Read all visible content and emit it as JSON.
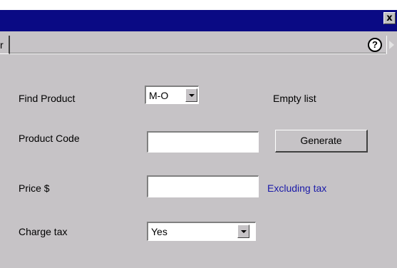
{
  "titlebar": {
    "close_glyph": "x"
  },
  "tabs": {
    "partial_tab_label": "r",
    "help_glyph": "?"
  },
  "form": {
    "find_product": {
      "label": "Find Product",
      "value": "M-O",
      "status": "Empty list"
    },
    "product_code": {
      "label": "Product Code",
      "value": "",
      "button_label": "Generate"
    },
    "price": {
      "label": "Price $",
      "value": "",
      "note": "Excluding tax"
    },
    "charge_tax": {
      "label": "Charge tax",
      "value": "Yes"
    }
  },
  "colors": {
    "titlebar": "#0a0a84",
    "panel": "#c6c3c6",
    "note_text": "#1a1aa8"
  },
  "icons": {
    "close": "close-icon",
    "help": "help-icon",
    "scroll_right": "scroll-right-icon",
    "dropdown": "chevron-down-icon"
  }
}
